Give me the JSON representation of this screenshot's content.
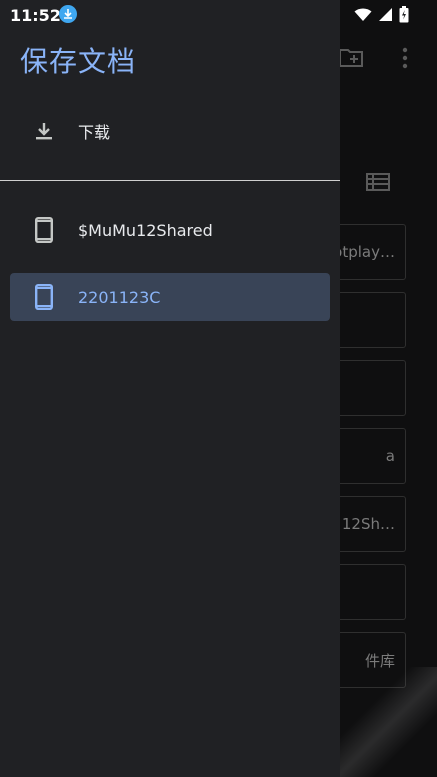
{
  "status_bar": {
    "time": "11:52"
  },
  "drawer": {
    "title": "保存文档",
    "items": [
      {
        "label": "下载",
        "icon": "download-icon"
      }
    ],
    "storage": [
      {
        "label": "$MuMu12Shared",
        "icon": "phone-icon",
        "selected": false
      },
      {
        "label": "2201123C",
        "icon": "phone-icon",
        "selected": true
      }
    ]
  },
  "background": {
    "cards": [
      "otplay…",
      "",
      "",
      "a",
      "12Sh…",
      "",
      "件库"
    ]
  },
  "colors": {
    "accent": "#8ab4f8",
    "drawer_bg": "#202124",
    "selected_bg": "#394457"
  }
}
